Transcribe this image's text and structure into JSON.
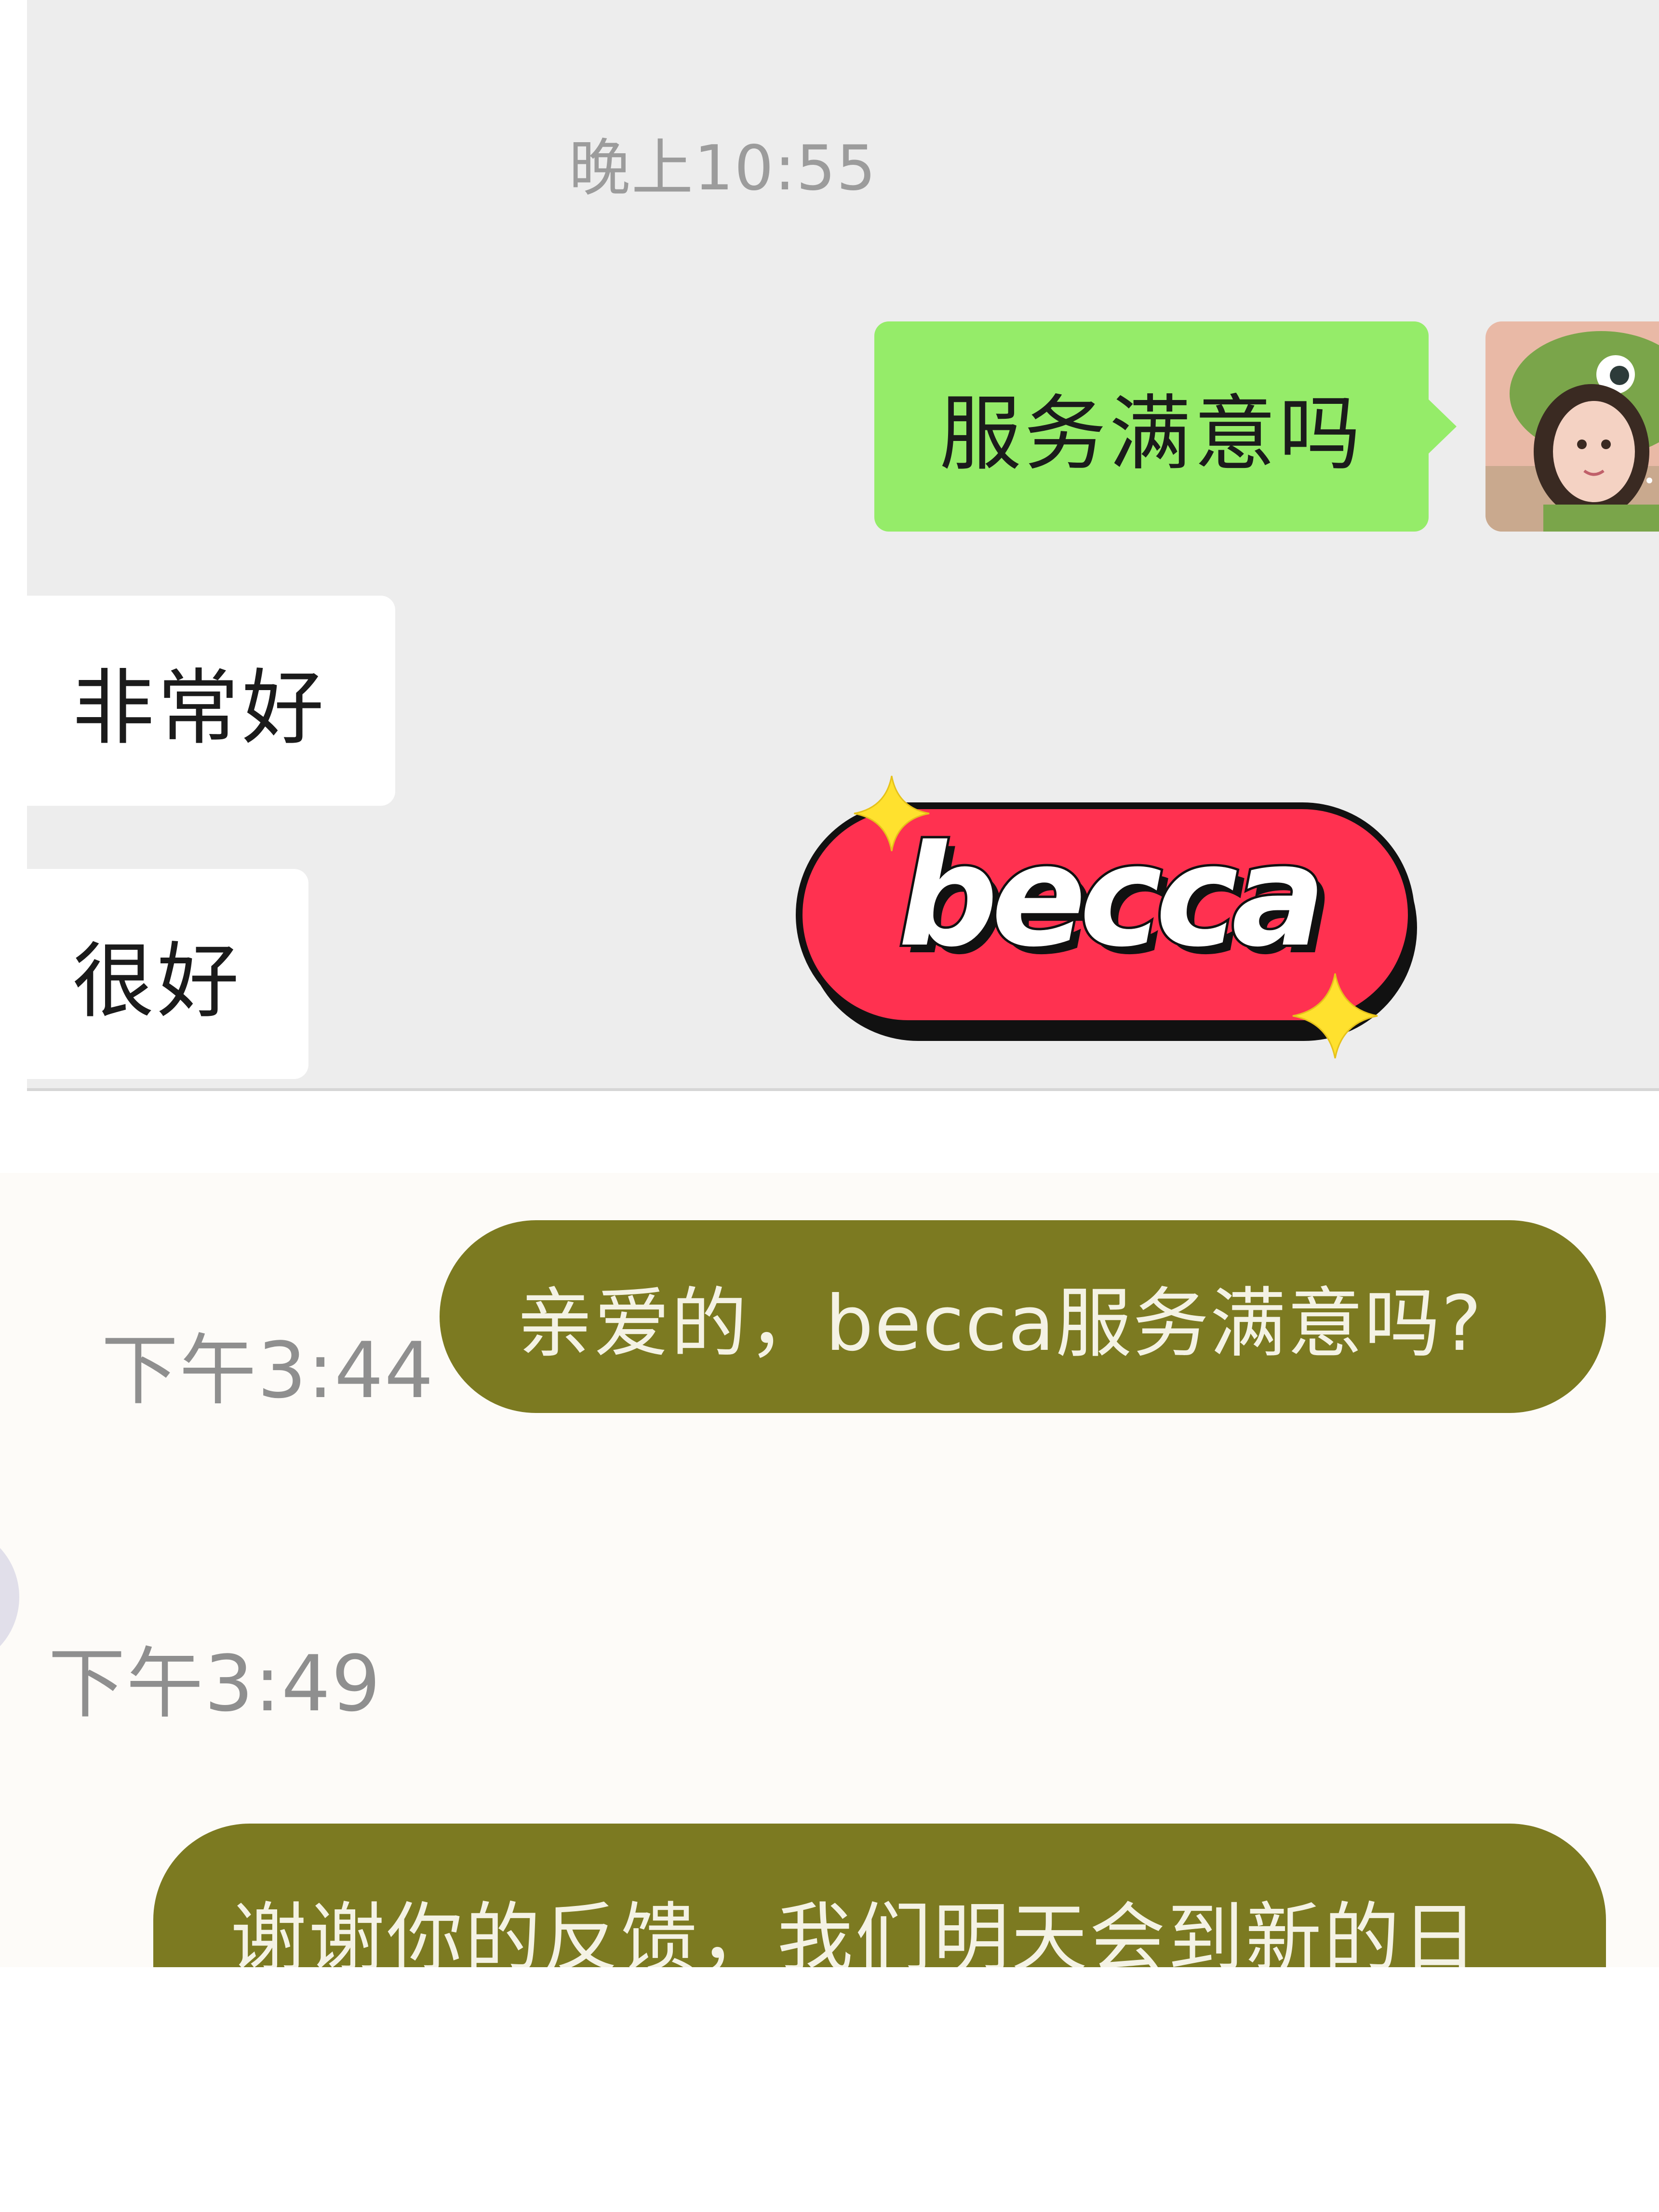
{
  "top_chat": {
    "timestamp": "晚上10:55",
    "outgoing_message": "服务满意吗",
    "incoming_messages": [
      "非常好",
      "很好"
    ],
    "avatar_icon": "avatar-girl-dino-hat-icon"
  },
  "sticker": {
    "label": "becca",
    "color": "#ff3150",
    "sparkle_color": "#ffe12e"
  },
  "bottom_chat": {
    "time_1": "下午3:44",
    "message_1": "亲爱的，becca服务满意吗?",
    "time_2": "下午3:49",
    "message_2": "谢谢你的反馈，我们明天会到新的日",
    "bubble_color": "#7c7a21"
  }
}
